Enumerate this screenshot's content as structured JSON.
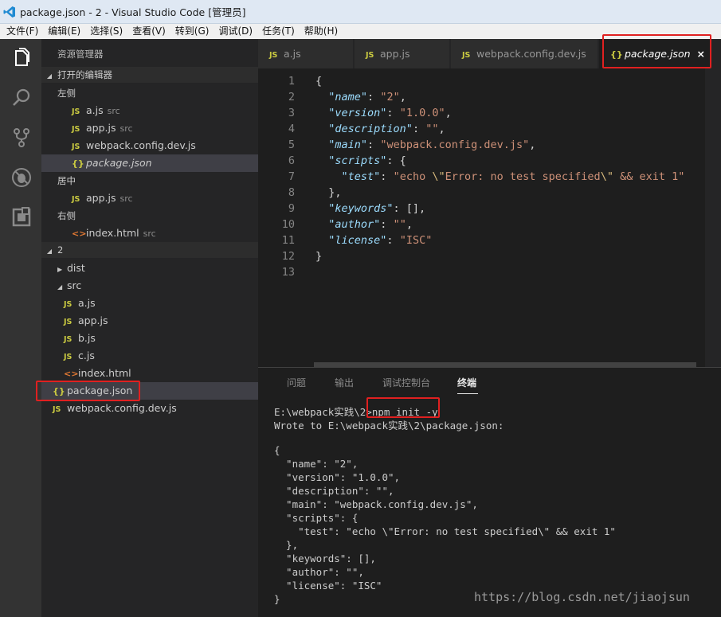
{
  "window": {
    "title": "package.json - 2 - Visual Studio Code [管理员]"
  },
  "menu": [
    "文件(F)",
    "编辑(E)",
    "选择(S)",
    "查看(V)",
    "转到(G)",
    "调试(D)",
    "任务(T)",
    "帮助(H)"
  ],
  "activity_icons": [
    "explorer-icon",
    "search-icon",
    "source-control-icon",
    "debug-icon",
    "extensions-icon"
  ],
  "sidebar": {
    "title": "资源管理器",
    "open_editors": {
      "label": "打开的编辑器",
      "groups": [
        {
          "label": "左侧",
          "files": [
            {
              "icon": "JS",
              "name": "a.js",
              "hint": "src"
            },
            {
              "icon": "JS",
              "name": "app.js",
              "hint": "src"
            },
            {
              "icon": "JS",
              "name": "webpack.config.dev.js",
              "hint": ""
            },
            {
              "icon": "{}",
              "name": "package.json",
              "hint": ""
            }
          ]
        },
        {
          "label": "居中",
          "files": [
            {
              "icon": "JS",
              "name": "app.js",
              "hint": "src"
            }
          ]
        },
        {
          "label": "右侧",
          "files": [
            {
              "icon": "<>",
              "name": "index.html",
              "hint": "src"
            }
          ]
        }
      ]
    },
    "workspace": {
      "label": "2",
      "tree": [
        {
          "name": "dist",
          "tri": "▶"
        },
        {
          "name": "src",
          "tri": "◢"
        },
        {
          "icon": "JS",
          "name": "a.js"
        },
        {
          "icon": "JS",
          "name": "app.js"
        },
        {
          "icon": "JS",
          "name": "b.js"
        },
        {
          "icon": "JS",
          "name": "c.js"
        },
        {
          "icon": "<>",
          "name": "index.html"
        },
        {
          "icon": "{}",
          "name": "package.json"
        },
        {
          "icon": "JS",
          "name": "webpack.config.dev.js"
        }
      ]
    }
  },
  "tabs": [
    {
      "icon": "JS",
      "label": "a.js"
    },
    {
      "icon": "JS",
      "label": "app.js"
    },
    {
      "icon": "JS",
      "label": "webpack.config.dev.js"
    },
    {
      "icon": "{}",
      "label": "package.json",
      "close": "×"
    }
  ],
  "editor": {
    "line_numbers": [
      "1",
      "2",
      "3",
      "4",
      "5",
      "6",
      "7",
      "8",
      "9",
      "10",
      "11",
      "12",
      "13"
    ],
    "lines": [
      "{",
      "  \"name\": \"2\",",
      "  \"version\": \"1.0.0\",",
      "  \"description\": \"\",",
      "  \"main\": \"webpack.config.dev.js\",",
      "  \"scripts\": {",
      "    \"test\": \"echo \\\"Error: no test specified\\\" && exit 1\"",
      "  },",
      "  \"keywords\": [],",
      "  \"author\": \"\",",
      "  \"license\": \"ISC\"",
      "}",
      ""
    ]
  },
  "panel": {
    "tabs": [
      "问题",
      "输出",
      "调试控制台",
      "终端"
    ],
    "prompt": "E:\\webpack实践\\2>",
    "command": "npm init -y",
    "output": [
      "Wrote to E:\\webpack实践\\2\\package.json:",
      "",
      "{",
      "  \"name\": \"2\",",
      "  \"version\": \"1.0.0\",",
      "  \"description\": \"\",",
      "  \"main\": \"webpack.config.dev.js\",",
      "  \"scripts\": {",
      "    \"test\": \"echo \\\"Error: no test specified\\\" && exit 1\"",
      "  },",
      "  \"keywords\": [],",
      "  \"author\": \"\",",
      "  \"license\": \"ISC\"",
      "}"
    ]
  },
  "watermark": "https://blog.csdn.net/jiaojsun",
  "colors": {
    "highlight_box": "#e02020",
    "json_key": "#9cdcfe",
    "json_string": "#ce9178",
    "js_icon": "#cbcb41"
  }
}
